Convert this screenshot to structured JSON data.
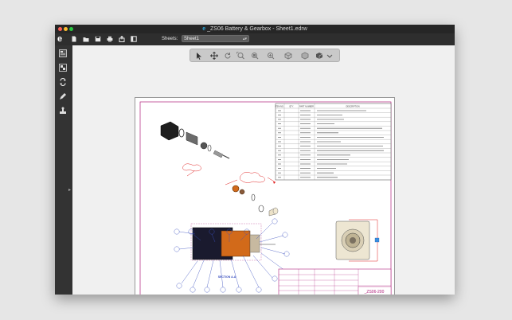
{
  "window": {
    "title": "_ZS06 Battery & Gearbox - Sheet1.edrw",
    "title_logo": "e",
    "traffic_lights": [
      "#fc5f57",
      "#fdbc2e",
      "#28c840"
    ]
  },
  "toolbar": {
    "logo": "e",
    "buttons": [
      "new-file-icon",
      "open-file-icon",
      "save-icon",
      "print-icon",
      "share-icon",
      "panel-icon"
    ],
    "sheets_label": "Sheets:",
    "sheets_value": "Sheet1"
  },
  "sidebar": {
    "buttons": [
      "sheets-panel-icon",
      "components-panel-icon",
      "configurations-icon",
      "markup-pen-icon",
      "measure-stamp-icon"
    ]
  },
  "view_toolbar": {
    "buttons": [
      "select-arrow-icon",
      "pan-icon",
      "rotate-icon",
      "zoom-to-fit-icon",
      "zoom-area-icon",
      "zoom-icon",
      "view-orientation-icon",
      "display-style-icon",
      "section-view-icon",
      "options-chevron-icon"
    ]
  },
  "drawing": {
    "section_label": "SECTION A-A",
    "bom_headers": [
      "ITEM NO.",
      "QTY.",
      "PART NUMBER",
      "DESCRIPTION"
    ],
    "drawing_number": "_ZS06-200"
  },
  "colors": {
    "accent": "#2aa6d9",
    "border_magenta": "#b0207c",
    "balloon_blue": "#3a4fbf",
    "markup_red": "#e02020"
  }
}
